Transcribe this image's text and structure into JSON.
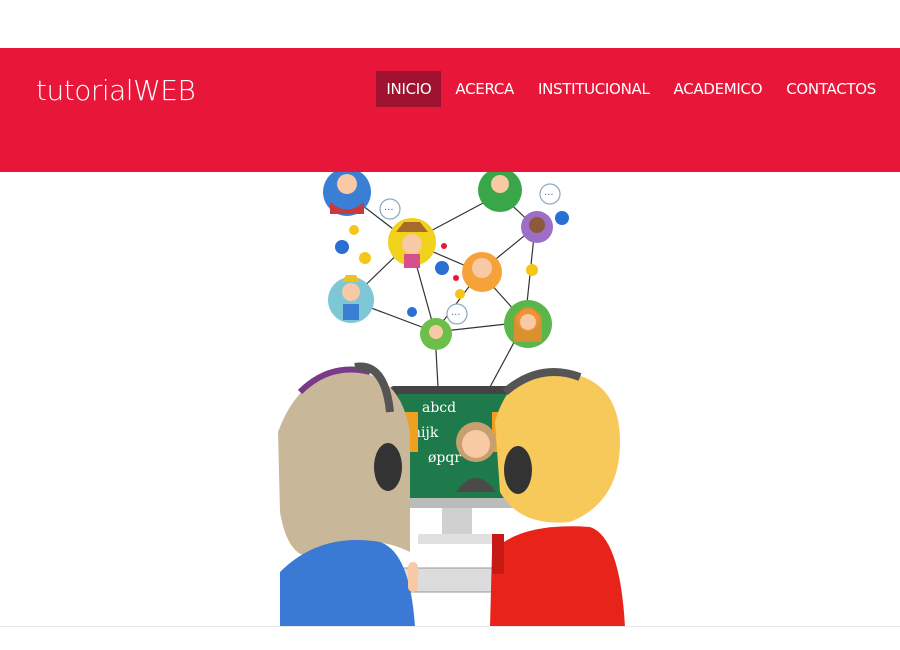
{
  "brand": {
    "name": "tutorialWEB"
  },
  "nav": {
    "items": [
      {
        "label": "INICIO",
        "active": true
      },
      {
        "label": "ACERCA",
        "active": false
      },
      {
        "label": "INSTITUCIONAL",
        "active": false
      },
      {
        "label": "ACADEMICO",
        "active": false
      },
      {
        "label": "CONTACTOS",
        "active": false
      }
    ]
  },
  "colors": {
    "navbar": "#e8173a",
    "active": "#9e1230"
  },
  "hero": {
    "board_text_top": "abcd",
    "board_text_mid": "hijk",
    "board_text_low": "øpqr"
  }
}
